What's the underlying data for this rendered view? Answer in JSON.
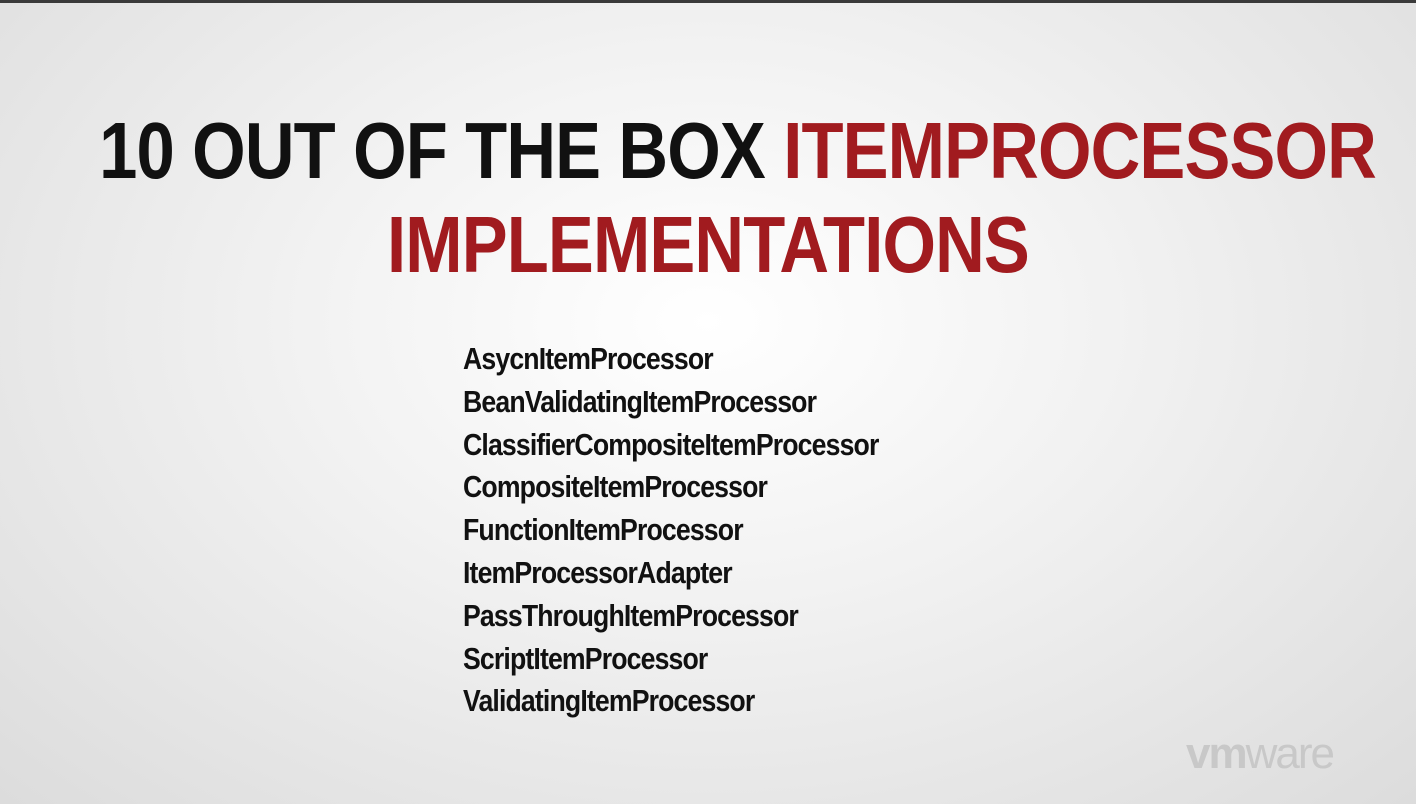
{
  "slide": {
    "title": {
      "line1_dark": "10 OUT OF THE BOX ",
      "line1_accent": "ITEMPROCESSOR",
      "line2_accent": "IMPLEMENTATIONS"
    },
    "items": [
      "AsycnItemProcessor",
      "BeanValidatingItemProcessor",
      "ClassifierCompositeItemProcessor",
      "CompositeItemProcessor",
      "FunctionItemProcessor",
      "ItemProcessorAdapter",
      "PassThroughItemProcessor",
      "ScriptItemProcessor",
      "ValidatingItemProcessor"
    ],
    "logo": {
      "vm": "vm",
      "ware": "ware"
    }
  },
  "colors": {
    "title_dark": "#111111",
    "title_accent": "#a11b1f",
    "logo": "#c8c8c8"
  }
}
